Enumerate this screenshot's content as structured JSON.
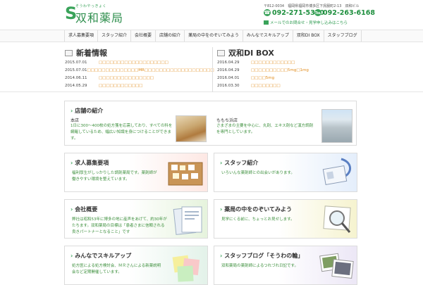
{
  "header": {
    "logo_ruby": "そうわやっきょく",
    "logo_text": "双和薬局",
    "address": "〒812-0034　福岡県福岡市博多区下呉服町2-13　双和ビル",
    "phone1": "092-271-5350",
    "phone2": "092-263-6168",
    "mail_link": "メールでのお問合せ・見学申し込みはこちら"
  },
  "nav": [
    "求人募集要項",
    "スタッフ紹介",
    "会社概要",
    "店舗の紹介",
    "薬局の中をのぞいてみよう",
    "みんなでスキルアップ",
    "双和DI BOX",
    "スタッフブログ"
  ],
  "news": {
    "title": "新着情報",
    "items": [
      {
        "date": "2015.07.01",
        "text": "□□□□□□□□□□□□□□□□□□□"
      },
      {
        "date": "2015.07.01",
        "text": "□□□□□□□□□□□□□□MR□□□□□□□□□□□□□□□□□□□"
      },
      {
        "date": "2014.06.11",
        "text": "□□□□□□□□□□□□□□□"
      },
      {
        "date": "2014.05.29",
        "text": "□□□□□□□□□□□□"
      }
    ]
  },
  "di_box": {
    "title": "双和DI BOX",
    "items": [
      {
        "date": "2016.04.29",
        "text": "□□□□□□□□□□□□"
      },
      {
        "date": "2016.04.29",
        "text": "□□□□□□□□□□5mg□1mg"
      },
      {
        "date": "2016.04.01",
        "text": "□□□□5mg"
      },
      {
        "date": "2016.03.30",
        "text": "□□□□□□□□"
      }
    ]
  },
  "store": {
    "title": "店舗の紹介",
    "main_name": "本店",
    "main_desc": "1日に300〜400枚の処方箋を応需しており、すべての科を網羅しているため、幅広い知識を身につけることができます。",
    "branch_name": "ももち浜店",
    "branch_desc": "さまざまの主要を中心に、丸剤、エキス剤など漢方調剤を専門としています。"
  },
  "cards": [
    {
      "title": "求人募集要項",
      "desc": "福利厚生がしっかりした調剤薬局です。薬剤師が働きやすい環境を整えています。"
    },
    {
      "title": "スタッフ紹介",
      "desc": "いろいんな薬剤師との出会いがあります。"
    },
    {
      "title": "会社概要",
      "desc": "弊社は昭和53年に博多の地に産声をあげて、約30年がたちます。双和薬局の目標は「患者さまに信頼される良きパートナーとなること」です"
    },
    {
      "title": "薬局の中をのぞいてみよう",
      "desc": "見学にくる前に、ちょっとお見せします。"
    },
    {
      "title": "みんなでスキルアップ",
      "desc": "処方医による処方検討会、ＭＲさんによる新薬説明会など定期開催しています。"
    },
    {
      "title": "スタッフブログ「そうわの輪」",
      "desc": "双和薬局の薬剤師によるつれづれ日記です。"
    }
  ],
  "colors": {
    "brand": "#3aa35a",
    "link": "#e08a18",
    "body_green": "#3c8f3c"
  }
}
